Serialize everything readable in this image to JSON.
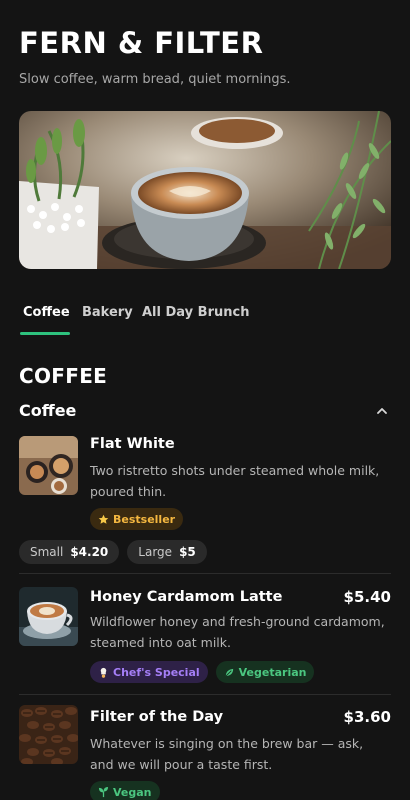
{
  "header": {
    "title": "FERN & FILTER",
    "tagline": "Slow coffee, warm bread, quiet mornings."
  },
  "tabs": [
    {
      "label": "Coffee",
      "active": true
    },
    {
      "label": "Bakery",
      "active": false
    },
    {
      "label": "All Day Brunch",
      "active": false
    }
  ],
  "section": {
    "heading": "COFFEE",
    "category": "Coffee",
    "expanded": true
  },
  "items": [
    {
      "name": "Flat White",
      "price": "",
      "description": "Two ristretto shots under steamed whole milk, poured thin.",
      "badges": [
        {
          "label": "Bestseller",
          "icon": "star-icon"
        }
      ],
      "sizes": [
        {
          "label": "Small",
          "price": "$4.20"
        },
        {
          "label": "Large",
          "price": "$5"
        }
      ]
    },
    {
      "name": "Honey Cardamom Latte",
      "price": "$5.40",
      "description": "Wildflower honey and fresh-ground cardamom, steamed into oat milk.",
      "badges": [
        {
          "label": "Chef's Special",
          "icon": "chef-icon"
        },
        {
          "label": "Vegetarian",
          "icon": "leaf-icon"
        }
      ]
    },
    {
      "name": "Filter of the Day",
      "price": "$3.60",
      "description": "Whatever is singing on the brew bar — ask, and we will pour a taste first.",
      "badges": [
        {
          "label": "Vegan",
          "icon": "seedling-icon"
        }
      ]
    }
  ],
  "colors": {
    "background": "#141414",
    "accent": "#2ec27e",
    "bestseller": "#f4b740",
    "special": "#a57ff7",
    "vegetarian": "#4bc780"
  }
}
